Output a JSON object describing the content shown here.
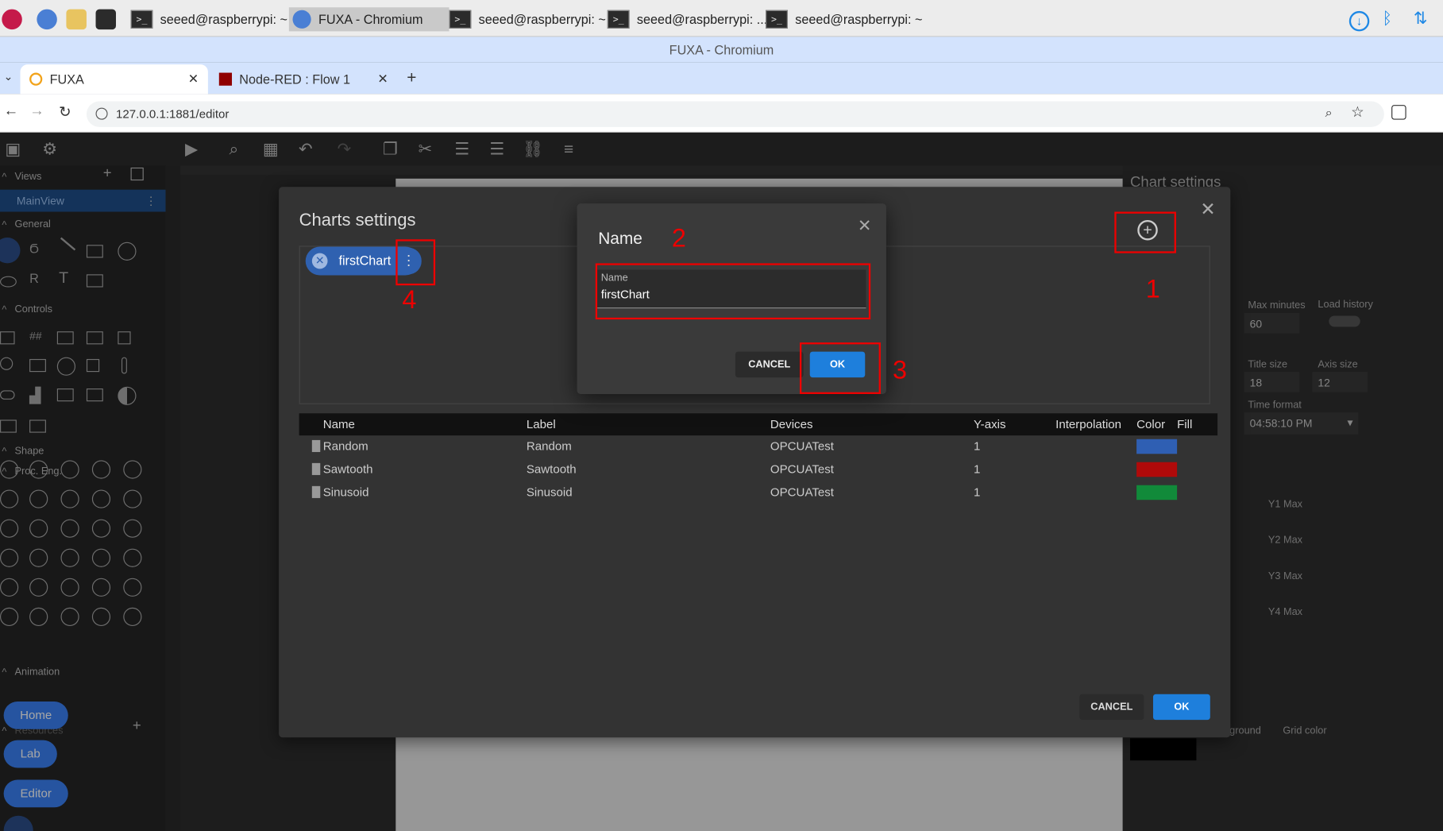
{
  "taskbar": {
    "tasks": [
      {
        "label": "seeed@raspberrypi: ~"
      },
      {
        "label": "FUXA - Chromium"
      },
      {
        "label": "seeed@raspberrypi: ~"
      },
      {
        "label": "seeed@raspberrypi: ..."
      },
      {
        "label": "seeed@raspberrypi: ~"
      }
    ]
  },
  "browser": {
    "window_title": "FUXA - Chromium",
    "tabs": [
      {
        "label": "FUXA"
      },
      {
        "label": "Node-RED : Flow 1"
      }
    ],
    "new_tab": "+",
    "url": "127.0.0.1:1881/editor"
  },
  "sidebar": {
    "views_label": "Views",
    "main_view": "MainView",
    "general_label": "General",
    "controls_label": "Controls",
    "shape_label": "Shape",
    "proc_label": "Proc. Eng.",
    "animation_label": "Animation",
    "resources_label": "Resources",
    "nav_buttons": [
      {
        "label": "Home"
      },
      {
        "label": "Lab"
      },
      {
        "label": "Editor"
      }
    ]
  },
  "right_panel": {
    "title": "Chart settings",
    "max_minutes_label": "Max minutes",
    "max_minutes": "60",
    "load_history_label": "Load history",
    "title_size_label": "Title size",
    "title_size": "18",
    "axis_size_label": "Axis size",
    "axis_size": "12",
    "time_format_label": "Time format",
    "time_format": "04:58:10 PM",
    "y1": "Y1 Max",
    "y2": "Y2 Max",
    "y3": "Y3 Max",
    "y4": "Y4 Max",
    "background_label": "ground",
    "grid_label": "Grid color"
  },
  "charts_dialog": {
    "title": "Charts settings",
    "chip_label": "firstChart",
    "columns": [
      "Name",
      "Label",
      "Devices",
      "Y-axis",
      "Interpolation",
      "Color",
      "Fill"
    ],
    "rows": [
      {
        "name": "Random",
        "label": "Random",
        "device": "OPCUATest",
        "yaxis": "1",
        "color": "#2f5fb3"
      },
      {
        "name": "Sawtooth",
        "label": "Sawtooth",
        "device": "OPCUATest",
        "yaxis": "1",
        "color": "#b00a0a"
      },
      {
        "name": "Sinusoid",
        "label": "Sinusoid",
        "device": "OPCUATest",
        "yaxis": "1",
        "color": "#118a3a"
      }
    ],
    "cancel": "CANCEL",
    "ok": "OK"
  },
  "name_dialog": {
    "title": "Name",
    "field_label": "Name",
    "field_value": "firstChart",
    "cancel": "CANCEL",
    "ok": "OK"
  },
  "annotations": [
    "1",
    "2",
    "3",
    "4"
  ]
}
